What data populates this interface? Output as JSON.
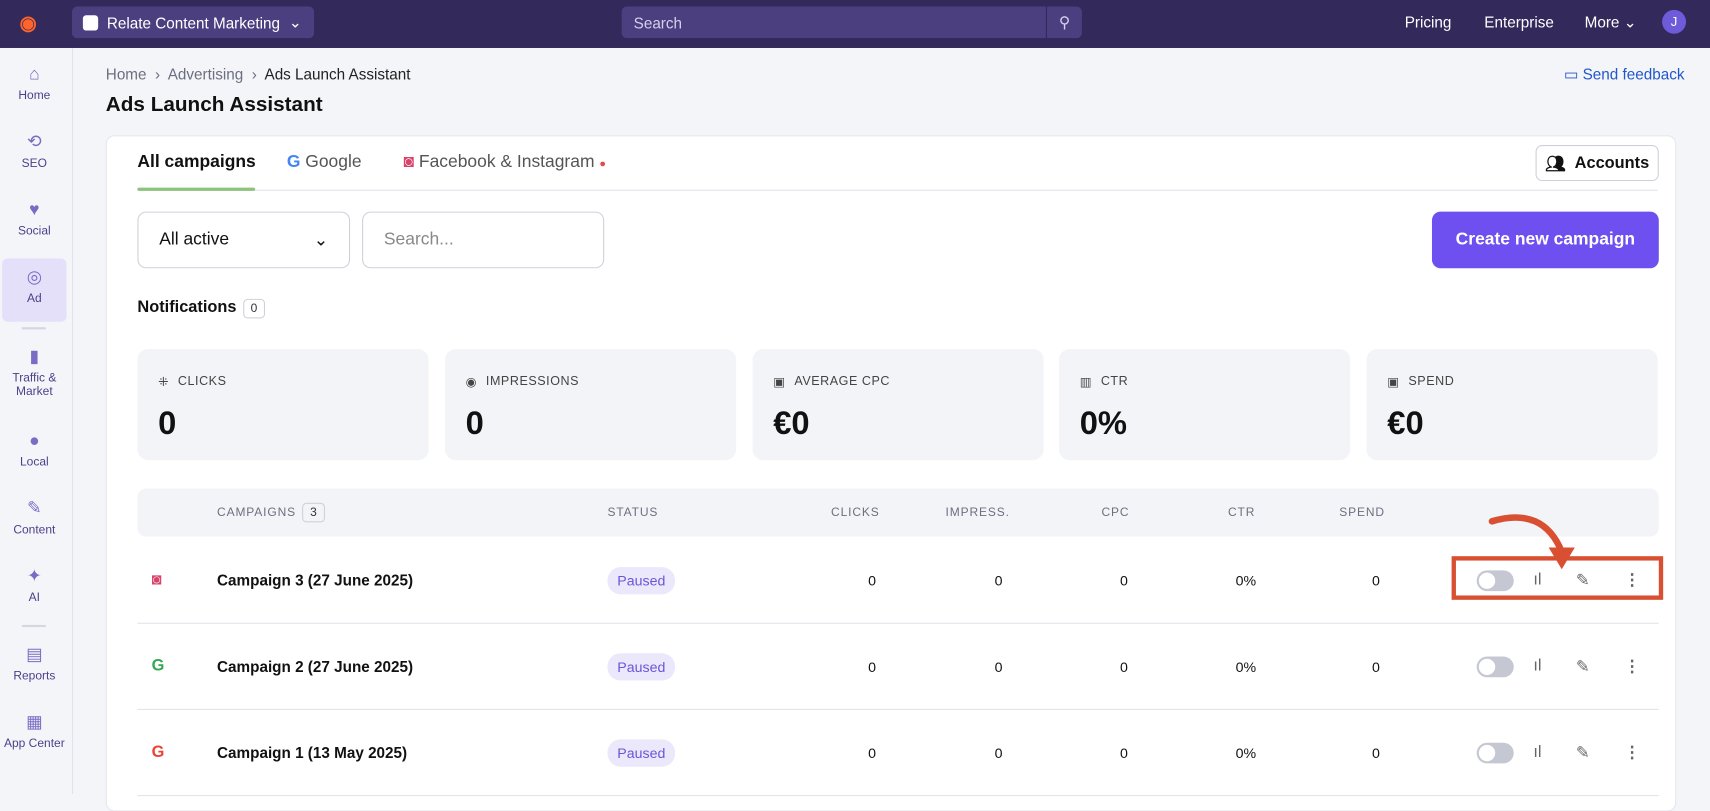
{
  "topbar": {
    "project": "Relate Content Marketing",
    "search_placeholder": "Search",
    "nav": [
      "Pricing",
      "Enterprise",
      "More"
    ],
    "avatar": "J"
  },
  "sidebar": {
    "items": [
      {
        "label": "Home",
        "icon": "home-icon"
      },
      {
        "label": "SEO",
        "icon": "seo-icon"
      },
      {
        "label": "Social",
        "icon": "social-icon"
      },
      {
        "label": "Ad",
        "icon": "ad-icon"
      },
      {
        "label": "Traffic & Market",
        "icon": "chart-icon"
      },
      {
        "label": "Local",
        "icon": "pin-icon"
      },
      {
        "label": "Content",
        "icon": "pen-icon"
      },
      {
        "label": "AI",
        "icon": "sparkle-icon"
      },
      {
        "label": "Reports",
        "icon": "doc-icon"
      },
      {
        "label": "App Center",
        "icon": "apps-icon"
      }
    ]
  },
  "breadcrumb": [
    "Home",
    "Advertising",
    "Ads Launch Assistant"
  ],
  "page_title": "Ads Launch Assistant",
  "feedback": "Send feedback",
  "tabs": [
    "All campaigns",
    "Google",
    "Facebook & Instagram"
  ],
  "accounts": "Accounts",
  "filter": {
    "selected": "All active",
    "search_placeholder": "Search..."
  },
  "create": "Create new campaign",
  "notifications": {
    "label": "Notifications",
    "count": "0"
  },
  "metrics": [
    {
      "label": "CLICKS",
      "value": "0"
    },
    {
      "label": "IMPRESSIONS",
      "value": "0"
    },
    {
      "label": "AVERAGE CPC",
      "value": "€0"
    },
    {
      "label": "CTR",
      "value": "0%"
    },
    {
      "label": "SPEND",
      "value": "€0"
    }
  ],
  "table": {
    "headers": [
      "CAMPAIGNS",
      "STATUS",
      "CLICKS",
      "IMPRESS.",
      "CPC",
      "CTR",
      "SPEND"
    ],
    "count": "3",
    "rows": [
      {
        "name": "Campaign 3 (27 June 2025)",
        "status": "Paused",
        "clicks": "0",
        "impress": "0",
        "cpc": "0",
        "ctr": "0%",
        "spend": "0",
        "platform": "facebook-instagram"
      },
      {
        "name": "Campaign 2 (27 June 2025)",
        "status": "Paused",
        "clicks": "0",
        "impress": "0",
        "cpc": "0",
        "ctr": "0%",
        "spend": "0",
        "platform": "google-search"
      },
      {
        "name": "Campaign 1 (13 May 2025)",
        "status": "Paused",
        "clicks": "0",
        "impress": "0",
        "cpc": "0",
        "ctr": "0%",
        "spend": "0",
        "platform": "google-pmax"
      }
    ]
  },
  "colors": {
    "accent": "#6e4ff0",
    "topbar": "#33295a",
    "highlight": "#d94f32"
  }
}
